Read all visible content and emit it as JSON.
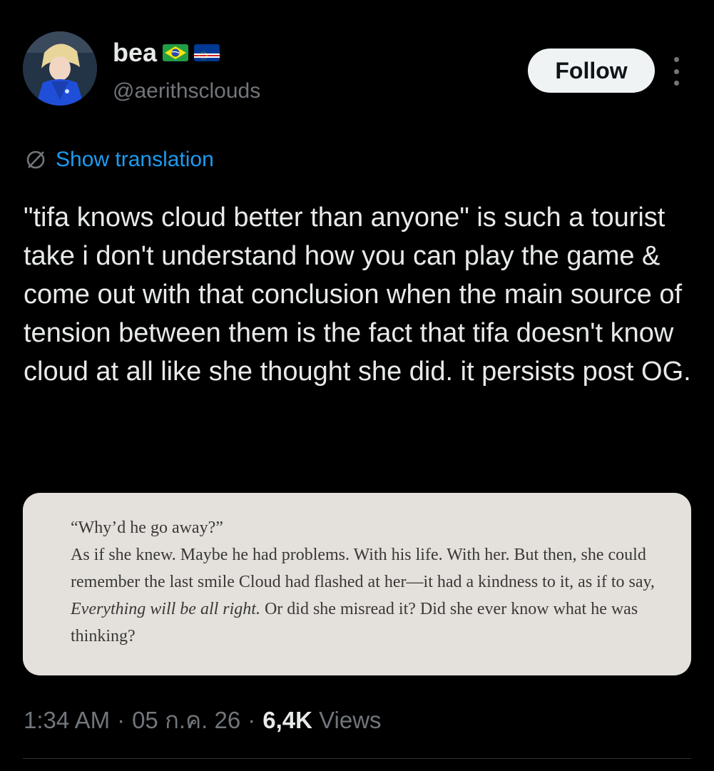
{
  "user": {
    "display_name": "bea",
    "handle": "@aerithsclouds",
    "avatar_icon": "avatar-image",
    "flags": [
      "brazil-flag-icon",
      "cape-verde-flag-icon"
    ]
  },
  "actions": {
    "follow_label": "Follow",
    "more_icon": "more-vertical-icon"
  },
  "translation": {
    "label": "Show translation",
    "icon": "globe-icon",
    "color": "#1d9bf0"
  },
  "tweet": {
    "text": "\"tifa knows cloud better than anyone\" is such a tourist take i don't understand how you can play the game & come out with that conclusion when the main source of tension between them is the fact that tifa doesn't know cloud at all like she thought she did. it persists post OG."
  },
  "media": {
    "line1": "“Why’d he go away?”",
    "para_start": "As if she knew. Maybe he had problems. With his life. With her. But then, she could remember the last smile Cloud had flashed at her—it had a kindness to it, as if to say, ",
    "para_italic": "Everything will be all right.",
    "para_end": " Or did she misread it? Did she ever know what he was thinking?"
  },
  "meta": {
    "time": "1:34 AM",
    "separator": "·",
    "date": "05 ก.ค. 26",
    "views_count": "6,4K",
    "views_label": "Views"
  },
  "colors": {
    "background": "#000000",
    "primary_text": "#e7e9ea",
    "secondary_text": "#71767b",
    "accent": "#1d9bf0"
  }
}
